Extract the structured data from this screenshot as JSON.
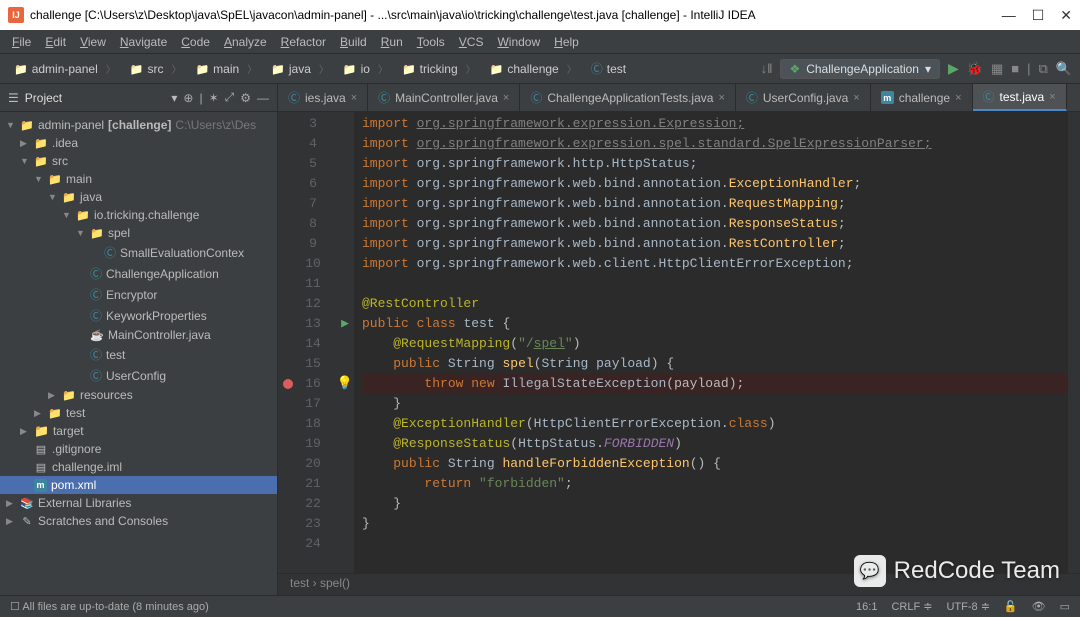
{
  "title": "challenge [C:\\Users\\z\\Desktop\\java\\SpEL\\javacon\\admin-panel] - ...\\src\\main\\java\\io\\tricking\\challenge\\test.java [challenge] - IntelliJ IDEA",
  "menu": [
    "File",
    "Edit",
    "View",
    "Navigate",
    "Code",
    "Analyze",
    "Refactor",
    "Build",
    "Run",
    "Tools",
    "VCS",
    "Window",
    "Help"
  ],
  "breadcrumb": [
    "admin-panel",
    "src",
    "main",
    "java",
    "io",
    "tricking",
    "challenge",
    "test"
  ],
  "runconfig": "ChallengeApplication",
  "project_header": "Project",
  "tree": [
    {
      "d": 0,
      "a": "open",
      "ic": "folder",
      "label": "admin-panel",
      "extra": "[challenge]",
      "dim": "C:\\Users\\z\\Des"
    },
    {
      "d": 1,
      "a": "closed",
      "ic": "folder",
      "label": ".idea"
    },
    {
      "d": 1,
      "a": "open",
      "ic": "folder",
      "label": "src"
    },
    {
      "d": 2,
      "a": "open",
      "ic": "folder-src",
      "label": "main"
    },
    {
      "d": 3,
      "a": "open",
      "ic": "folder-src",
      "label": "java"
    },
    {
      "d": 4,
      "a": "open",
      "ic": "folder",
      "label": "io.tricking.challenge"
    },
    {
      "d": 5,
      "a": "open",
      "ic": "folder",
      "label": "spel"
    },
    {
      "d": 6,
      "a": "none",
      "ic": "class",
      "label": "SmallEvaluationContex"
    },
    {
      "d": 5,
      "a": "none",
      "ic": "class",
      "label": "ChallengeApplication"
    },
    {
      "d": 5,
      "a": "none",
      "ic": "class",
      "label": "Encryptor"
    },
    {
      "d": 5,
      "a": "none",
      "ic": "class",
      "label": "KeyworkProperties"
    },
    {
      "d": 5,
      "a": "none",
      "ic": "java",
      "label": "MainController.java"
    },
    {
      "d": 5,
      "a": "none",
      "ic": "class",
      "label": "test"
    },
    {
      "d": 5,
      "a": "none",
      "ic": "class",
      "label": "UserConfig"
    },
    {
      "d": 3,
      "a": "closed",
      "ic": "folder",
      "label": "resources"
    },
    {
      "d": 2,
      "a": "closed",
      "ic": "folder",
      "label": "test"
    },
    {
      "d": 1,
      "a": "closed",
      "ic": "folder-orange",
      "label": "target"
    },
    {
      "d": 1,
      "a": "none",
      "ic": "file",
      "label": ".gitignore"
    },
    {
      "d": 1,
      "a": "none",
      "ic": "file",
      "label": "challenge.iml"
    },
    {
      "d": 1,
      "a": "none",
      "ic": "m",
      "label": "pom.xml",
      "sel": true
    },
    {
      "d": 0,
      "a": "closed",
      "ic": "lib",
      "label": "External Libraries"
    },
    {
      "d": 0,
      "a": "closed",
      "ic": "scratch",
      "label": "Scratches and Consoles"
    }
  ],
  "tabs": [
    {
      "label": "ies.java"
    },
    {
      "label": "MainController.java"
    },
    {
      "label": "ChallengeApplicationTests.java"
    },
    {
      "label": "UserConfig.java"
    },
    {
      "label": "challenge",
      "icon": "m"
    },
    {
      "label": "test.java",
      "active": true
    }
  ],
  "code_start_line": 3,
  "code": [
    {
      "html": "<span class='k'>import</span> <span class='pkg-dim'>org.springframework.expression.Expression;</span>"
    },
    {
      "html": "<span class='k'>import</span> <span class='pkg-dim'>org.springframework.expression.spel.standard.SpelExpressionParser;</span>"
    },
    {
      "html": "<span class='k'>import</span> <span class='t'>org.springframework.http.HttpStatus;</span>"
    },
    {
      "html": "<span class='k'>import</span> <span class='t'>org.springframework.web.bind.annotation.</span><span class='fn'>ExceptionHandler</span>;"
    },
    {
      "html": "<span class='k'>import</span> <span class='t'>org.springframework.web.bind.annotation.</span><span class='fn'>RequestMapping</span>;"
    },
    {
      "html": "<span class='k'>import</span> <span class='t'>org.springframework.web.bind.annotation.</span><span class='fn'>ResponseStatus</span>;"
    },
    {
      "html": "<span class='k'>import</span> <span class='t'>org.springframework.web.bind.annotation.</span><span class='fn'>RestController</span>;"
    },
    {
      "html": "<span class='k'>import</span> <span class='t'>org.springframework.web.client.HttpClientErrorException;</span>"
    },
    {
      "html": ""
    },
    {
      "html": "<span class='a'>@RestController</span>"
    },
    {
      "html": "<span class='k'>public class</span> <span class='t'>test</span> {",
      "icon": "run"
    },
    {
      "html": "    <span class='a'>@RequestMapping</span>(<span class='s'>\"/<u>spel</u>\"</span>)"
    },
    {
      "html": "    <span class='k'>public</span> <span class='t'>String</span> <span class='fn'>spel</span>(<span class='t'>String payload</span>) {"
    },
    {
      "html": "        <span class='k'>throw new</span> <span class='t'>IllegalStateException</span>(payload);",
      "bp": true,
      "bulb": true,
      "hl": true
    },
    {
      "html": "    }"
    },
    {
      "html": "    <span class='a'>@ExceptionHandler</span>(<span class='t'>HttpClientErrorException</span>.<span class='k'>class</span>)"
    },
    {
      "html": "    <span class='a'>@ResponseStatus</span>(<span class='t'>HttpStatus</span>.<span class='const'>FORBIDDEN</span>)"
    },
    {
      "html": "    <span class='k'>public</span> <span class='t'>String</span> <span class='fn'>handleForbiddenException</span>() {"
    },
    {
      "html": "        <span class='k'>return</span> <span class='s'>\"forbidden\"</span>;"
    },
    {
      "html": "    }"
    },
    {
      "html": "}"
    },
    {
      "html": ""
    }
  ],
  "editor_breadcrumb": "test  ›  spel()",
  "status_left": "All files are up-to-date (8 minutes ago)",
  "status_right": {
    "pos": "16:1",
    "sep": "CRLF",
    "enc": "UTF-8"
  },
  "watermark": "RedCode Team"
}
